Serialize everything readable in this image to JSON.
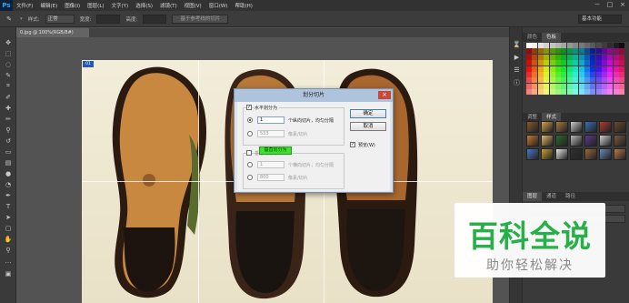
{
  "menubar": {
    "logo": "Ps",
    "items": [
      "文件(F)",
      "编辑(E)",
      "图像(I)",
      "图层(L)",
      "文字(Y)",
      "选择(S)",
      "滤镜(T)",
      "视图(V)",
      "窗口(W)",
      "帮助(H)"
    ],
    "window_controls": [
      "－",
      "□",
      "×"
    ]
  },
  "options_bar": {
    "style_label": "样式:",
    "style_value": "正常",
    "width_label": "宽度:",
    "height_label": "高度:",
    "slice_button": "基于参考线的切片",
    "workspace": "基本功能"
  },
  "document": {
    "tab_title": "0.jpg @ 100%(RGB/8#)"
  },
  "canvas": {
    "slice_badge": "01"
  },
  "dialog": {
    "title": "划分切片",
    "close": "×",
    "horizontal_checkbox": "水平划分为",
    "horizontal_radio1_suffix": "个纵向切片，均匀分隔",
    "horizontal_value": "1",
    "horizontal_radio2_value": "533",
    "horizontal_radio2_suffix": "像素/切片",
    "vertical_checkbox": "垂直划分为",
    "vertical_radio1_value": "1",
    "vertical_radio1_suffix": "个横向切片，均匀分隔",
    "vertical_radio2_value": "800",
    "vertical_radio2_suffix": "像素/切片",
    "ok_button": "确定",
    "cancel_button": "取消",
    "preview_checkbox": "预览(W)"
  },
  "panels": {
    "top_tabs": [
      "颜色",
      "色板"
    ],
    "mid_tabs": [
      "调整",
      "样式"
    ],
    "bottom_tabs": [
      "图层",
      "通道",
      "路径"
    ]
  },
  "watermark": {
    "title": "百科全说",
    "subtitle": "助你轻松解决"
  },
  "colors": {
    "accent_green": "#27b048",
    "highlight_green": "#40e030",
    "fg_swatch": "#1567c2"
  }
}
